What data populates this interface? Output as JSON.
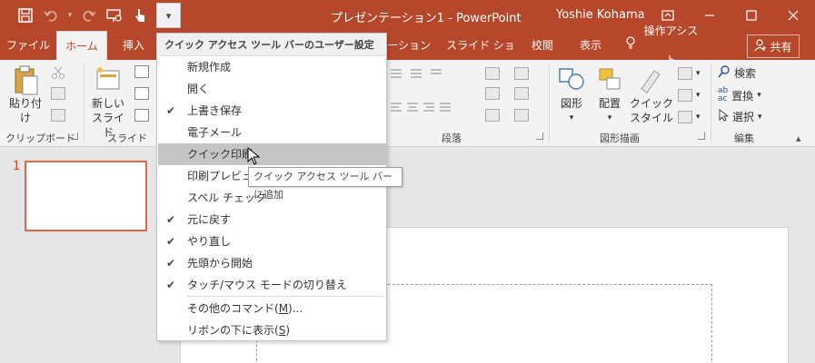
{
  "window": {
    "title": "プレゼンテーション1 - PowerPoint",
    "user": "Yoshie Kohama",
    "ribbon_display_icon": "ribbon-display-options-icon",
    "minimize_icon": "minimize-icon",
    "maximize_icon": "maximize-icon",
    "close_icon": "close-icon",
    "accent_color": "#b7472a"
  },
  "qat": {
    "buttons": [
      "save-icon",
      "undo-icon",
      "redo-icon",
      "presentation-start-icon",
      "touch-mouse-mode-icon",
      "customize-qat-icon"
    ]
  },
  "tabs": [
    {
      "label": "ファイル"
    },
    {
      "label": "ホーム",
      "active": true
    },
    {
      "label": "挿入"
    },
    {
      "label": "アニメーション"
    },
    {
      "label": "スライド ショー"
    },
    {
      "label": "校閲"
    },
    {
      "label": "表示"
    },
    {
      "label": "操作アシスト"
    }
  ],
  "share": {
    "label": "共有"
  },
  "ribbon": {
    "groups": {
      "clipboard": "クリップボード",
      "slides": "スライド",
      "paragraph": "段落",
      "drawing": "図形描画",
      "editing": "編集"
    },
    "paste": "貼り付け",
    "new_slide_line1": "新しい",
    "new_slide_line2": "スライド",
    "shape": "図形",
    "arrange": "配置",
    "quick_style_line1": "クイック",
    "quick_style_line2": "スタイル",
    "find": "検索",
    "replace": "置換",
    "select": "選択"
  },
  "menu": {
    "header": "クイック アクセス ツール バーのユーザー設定",
    "items": [
      {
        "label": "新規作成",
        "checked": false
      },
      {
        "label": "開く",
        "checked": false
      },
      {
        "label": "上書き保存",
        "checked": true
      },
      {
        "label": "電子メール",
        "checked": false
      },
      {
        "label": "クイック印刷",
        "checked": false,
        "hover": true
      },
      {
        "label": "印刷プレビュー",
        "checked": false
      },
      {
        "label": "スペル チェック",
        "checked": false
      },
      {
        "label": "元に戻す",
        "checked": true
      },
      {
        "label": "やり直し",
        "checked": true
      },
      {
        "label": "先頭から開始",
        "checked": true
      },
      {
        "label": "タッチ/マウス モードの切り替え",
        "checked": true
      }
    ],
    "more_commands_prefix": "その他のコマンド(",
    "more_commands_key": "M",
    "more_commands_suffix": ")...",
    "show_below_prefix": "リボンの下に表示(",
    "show_below_key": "S",
    "show_below_suffix": ")"
  },
  "tooltip": "クイック アクセス ツール バーに追加",
  "thumbnail": {
    "number": "1"
  }
}
